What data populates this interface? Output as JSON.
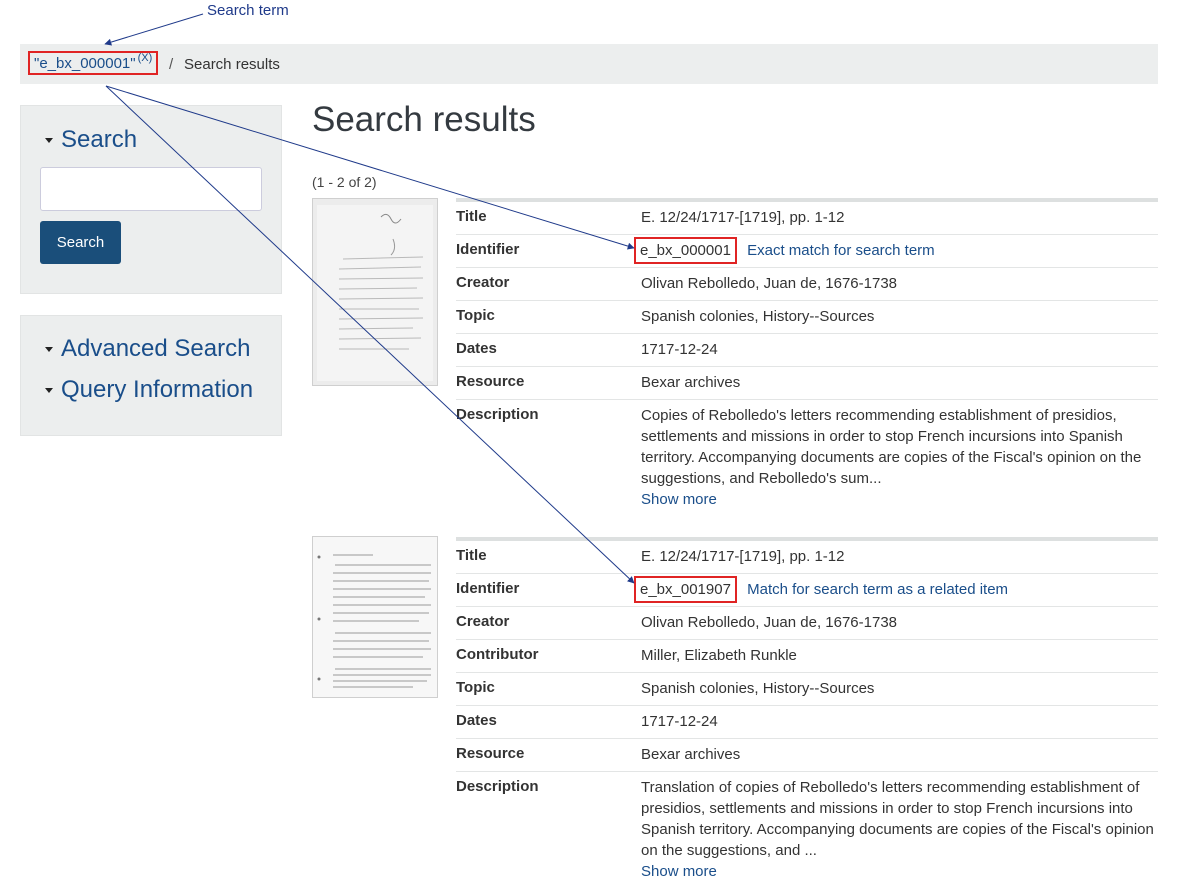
{
  "annotation": {
    "label": "Search term"
  },
  "breadcrumb": {
    "term": "\"e_bx_000001\"",
    "remove": "(X)",
    "separator": "/",
    "current": "Search results"
  },
  "sidebar": {
    "search_heading": "Search",
    "search_input_value": "",
    "search_button": "Search",
    "advanced_heading": "Advanced Search",
    "query_heading": "Query Information"
  },
  "main": {
    "title": "Search results",
    "count": "(1 - 2 of 2)"
  },
  "results": [
    {
      "title_label": "Title",
      "title": "E. 12/24/1717-[1719], pp. 1-12",
      "identifier_label": "Identifier",
      "identifier": "e_bx_000001",
      "identifier_note": "Exact match for search term",
      "creator_label": "Creator",
      "creator": "Olivan Rebolledo, Juan de, 1676-1738",
      "topic_label": "Topic",
      "topic": "Spanish colonies, History--Sources",
      "dates_label": "Dates",
      "dates": "1717-12-24",
      "resource_label": "Resource",
      "resource": "Bexar archives",
      "description_label": "Description",
      "description": "Copies of Rebolledo's letters recommending establishment of presidios, settlements and missions in order to stop French incursions into Spanish territory. Accompanying documents are copies of the Fiscal's opinion on the suggestions, and Rebolledo's sum...",
      "show_more": "Show more"
    },
    {
      "title_label": "Title",
      "title": "E. 12/24/1717-[1719], pp. 1-12",
      "identifier_label": "Identifier",
      "identifier": "e_bx_001907",
      "identifier_note": "Match for search term as a related item",
      "creator_label": "Creator",
      "creator": "Olivan Rebolledo, Juan de, 1676-1738",
      "contributor_label": "Contributor",
      "contributor": "Miller, Elizabeth Runkle",
      "topic_label": "Topic",
      "topic": "Spanish colonies, History--Sources",
      "dates_label": "Dates",
      "dates": "1717-12-24",
      "resource_label": "Resource",
      "resource": "Bexar archives",
      "description_label": "Description",
      "description": "Translation of copies of Rebolledo's letters recommending establishment of presidios, settlements and missions in order to stop French incursions into Spanish territory. Accompanying documents are copies of the Fiscal's opinion on the suggestions, and ...",
      "show_more": "Show more"
    }
  ],
  "colors": {
    "link": "#1a4e8a",
    "highlight": "#e02424",
    "button": "#1a4e7a",
    "annotation_arrow": "#1f3a8a"
  }
}
